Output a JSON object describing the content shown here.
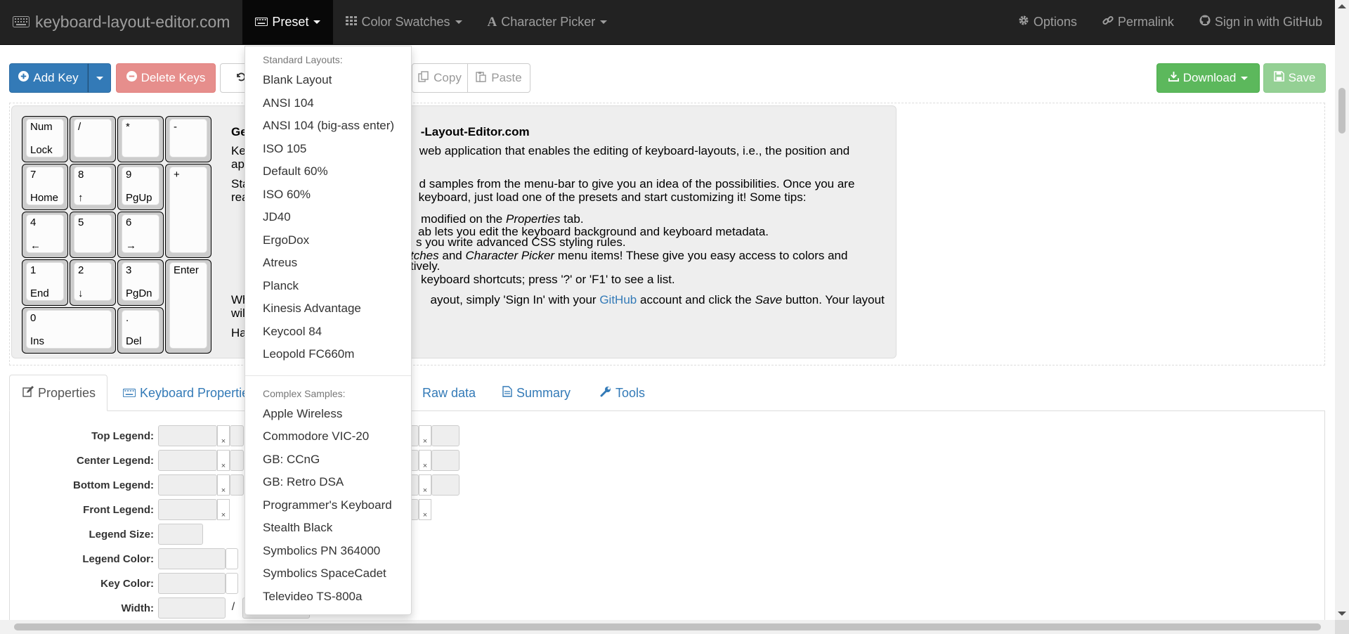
{
  "navbar": {
    "brand": "keyboard-layout-editor.com",
    "preset": "Preset",
    "color_swatches": "Color Swatches",
    "character_picker": "Character Picker",
    "options": "Options",
    "permalink": "Permalink",
    "signin": "Sign in with GitHub"
  },
  "toolbar": {
    "add_key": "Add Key",
    "delete_keys": "Delete Keys",
    "copy": "Copy",
    "paste": "Paste",
    "download": "Download",
    "save": "Save"
  },
  "keys": [
    {
      "top": "Num",
      "bottom": "Lock"
    },
    {
      "top": "/",
      "bottom": ""
    },
    {
      "top": "*",
      "bottom": ""
    },
    {
      "top": "-",
      "bottom": ""
    },
    {
      "top": "7",
      "bottom": "Home"
    },
    {
      "top": "8",
      "bottom": "↑"
    },
    {
      "top": "9",
      "bottom": "PgUp"
    },
    {
      "top": "+",
      "bottom": ""
    },
    {
      "top": "4",
      "bottom": "←"
    },
    {
      "top": "5",
      "bottom": ""
    },
    {
      "top": "6",
      "bottom": "→"
    },
    {
      "top": "1",
      "bottom": "End"
    },
    {
      "top": "2",
      "bottom": "↓"
    },
    {
      "top": "3",
      "bottom": "PgDn"
    },
    {
      "top": "Enter",
      "bottom": ""
    },
    {
      "top": "0",
      "bottom": "Ins"
    },
    {
      "top": ".",
      "bottom": "Del"
    }
  ],
  "welcome": {
    "title_a": "Ge",
    "title_b": "-Layout-Editor.com",
    "p1_a": "Ke",
    "p1_b": "web application that enables the editing of keyboard-layouts, i.e., the position and",
    "p1_c": "ap",
    "p2_a": "Sta",
    "p2_b": "d samples from the menu-bar to give you an idea of the possibilities. Once you are",
    "p2_c": "rea",
    "p2_d": "keyboard, just load one of the presets and start customizing it! Some tips:",
    "tip1_a": "modified on the",
    "tip1_em": "Properties",
    "tip1_b": "tab.",
    "tip2": "ab lets you edit the keyboard background and keyboard metadata.",
    "tip3": "s you write advanced CSS styling rules.",
    "tip4_em1": "tches",
    "tip4_a": "and",
    "tip4_em2": "Character Picker",
    "tip4_b": "menu items! These give you easy access to colors and",
    "tip4_c": "tively.",
    "tip5": "keyboard shortcuts; press '?' or 'F1' to see a list.",
    "p3_a": "Wh",
    "p3_b": "ayout, simply 'Sign In' with your",
    "p3_link": "GitHub",
    "p3_c": "account and click the",
    "p3_em": "Save",
    "p3_d": "button. Your layout",
    "p3_e": "wil",
    "p4": "Ha"
  },
  "tabs": {
    "properties": "Properties",
    "keyboard_properties": "Keyboard Properties",
    "raw_data": "Raw data",
    "summary": "Summary",
    "tools": "Tools"
  },
  "props": {
    "top_legend": "Top Legend:",
    "center_legend": "Center Legend:",
    "bottom_legend": "Bottom Legend:",
    "front_legend": "Front Legend:",
    "legend_size": "Legend Size:",
    "legend_color": "Legend Color:",
    "key_color": "Key Color:",
    "width": "Width:",
    "slash": "/",
    "x": "×"
  },
  "dropdown": {
    "standard_header": "Standard Layouts:",
    "standard": [
      "Blank Layout",
      "ANSI 104",
      "ANSI 104 (big-ass enter)",
      "ISO 105",
      "Default 60%",
      "ISO 60%",
      "JD40",
      "ErgoDox",
      "Atreus",
      "Planck",
      "Kinesis Advantage",
      "Keycool 84",
      "Leopold FC660m"
    ],
    "complex_header": "Complex Samples:",
    "complex": [
      "Apple Wireless",
      "Commodore VIC-20",
      "GB: CCnG",
      "GB: Retro DSA",
      "Programmer's Keyboard",
      "Stealth Black",
      "Symbolics PN 364000",
      "Symbolics SpaceCadet",
      "Televideo TS-800a"
    ]
  }
}
